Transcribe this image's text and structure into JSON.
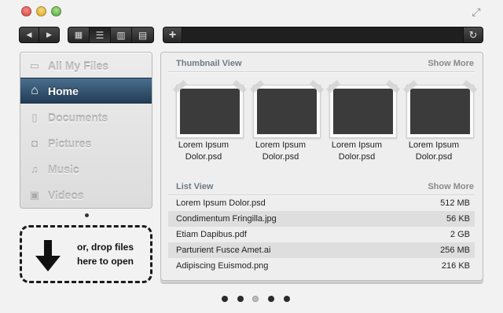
{
  "window": {
    "controls": [
      "close",
      "minimize",
      "zoom"
    ],
    "resize_icon": "fullscreen-arrows-icon"
  },
  "toolbar": {
    "nav": [
      {
        "icon": "back-arrow-icon",
        "glyph": "◀"
      },
      {
        "icon": "forward-arrow-icon",
        "glyph": "▶"
      }
    ],
    "views": [
      {
        "icon": "grid-view-icon",
        "glyph": "▦",
        "active": false
      },
      {
        "icon": "list-view-icon",
        "glyph": "☰",
        "active": true
      },
      {
        "icon": "column-view-icon",
        "glyph": "▥",
        "active": false
      },
      {
        "icon": "coverflow-view-icon",
        "glyph": "▤",
        "active": false
      }
    ],
    "add_glyph": "+",
    "refresh_glyph": "↻"
  },
  "sidebar": {
    "items": [
      {
        "label": "All My Files",
        "icon": "folder-icon",
        "glyph": "▭",
        "active": false
      },
      {
        "label": "Home",
        "icon": "home-icon",
        "glyph": "⌂",
        "active": true
      },
      {
        "label": "Documents",
        "icon": "document-icon",
        "glyph": "▯",
        "active": false
      },
      {
        "label": "Pictures",
        "icon": "camera-icon",
        "glyph": "◘",
        "active": false
      },
      {
        "label": "Music",
        "icon": "music-note-icon",
        "glyph": "♫",
        "active": false
      },
      {
        "label": "Videos",
        "icon": "film-icon",
        "glyph": "▣",
        "active": false
      }
    ]
  },
  "dropzone": {
    "line1": "or, drop files",
    "line2": "here to open"
  },
  "thumbnail_view": {
    "title": "Thumbnail View",
    "show_more": "Show More",
    "items": [
      {
        "line1": "Lorem Ipsum",
        "line2": "Dolor.psd"
      },
      {
        "line1": "Lorem Ipsum",
        "line2": "Dolor.psd"
      },
      {
        "line1": "Lorem Ipsum",
        "line2": "Dolor.psd"
      },
      {
        "line1": "Lorem Ipsum",
        "line2": "Dolor.psd"
      }
    ]
  },
  "list_view": {
    "title": "List View",
    "show_more": "Show More",
    "rows": [
      {
        "name": "Lorem Ipsum Dolor.psd",
        "size": "512 MB"
      },
      {
        "name": "Condimentum Fringilla.jpg",
        "size": "56 KB"
      },
      {
        "name": "Etiam Dapibus.pdf",
        "size": "2 GB"
      },
      {
        "name": "Parturient Fusce Amet.ai",
        "size": "256 MB"
      },
      {
        "name": "Adipiscing Euismod.png",
        "size": "216 KB"
      }
    ]
  },
  "pager": {
    "count": 5,
    "current": 3
  },
  "colors": {
    "accent": "#2c4a66",
    "panel_bg": "#eeeeee",
    "photo": "#3b3b3b"
  }
}
